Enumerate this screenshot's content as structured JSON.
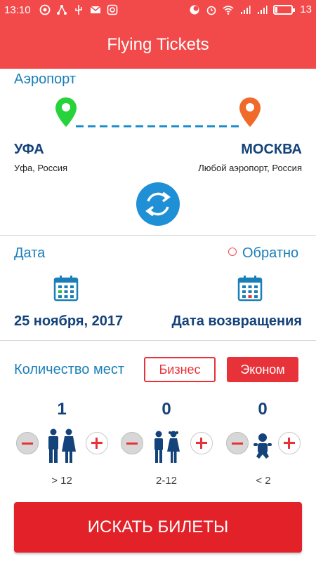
{
  "status_bar": {
    "time": "13:10",
    "battery": "13",
    "battery_fraction": 0.13
  },
  "app": {
    "title": "Flying Tickets"
  },
  "airport": {
    "section_label": "Аэропорт",
    "from": {
      "city": "УФА",
      "details": "Уфа, Россия"
    },
    "to": {
      "city": "МОСКВА",
      "details": "Любой аэропорт, Россия"
    }
  },
  "dates": {
    "section_label": "Дата",
    "return_toggle_label": "Обратно",
    "departure_value": "25 ноября, 2017",
    "return_value": "Дата возвращения"
  },
  "seats": {
    "section_label": "Количество мест",
    "class_options": [
      "Бизнес",
      "Эконом"
    ],
    "selected_class": "Эконом",
    "passengers": [
      {
        "count": "1",
        "age": "> 12"
      },
      {
        "count": "0",
        "age": "2-12"
      },
      {
        "count": "0",
        "age": "< 2"
      }
    ]
  },
  "actions": {
    "search_label": "ИСКАТЬ БИЛЕТЫ"
  },
  "colors": {
    "primary": "#f24a4a",
    "accent": "#1a7fb8",
    "dark_text": "#14427a",
    "button_red": "#e32129",
    "pin_from": "#27d33b",
    "pin_to": "#f06a2a"
  }
}
